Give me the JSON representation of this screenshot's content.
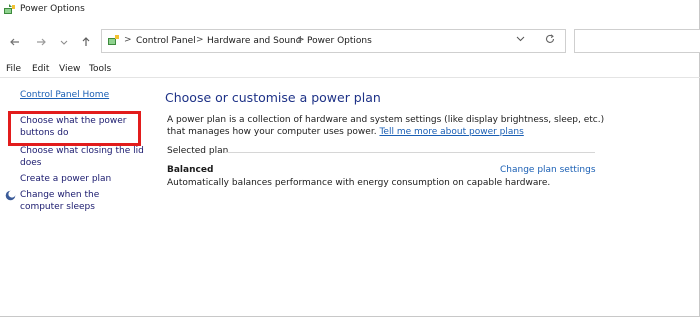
{
  "window": {
    "title": "Power Options"
  },
  "nav": {
    "back_icon": "back-arrow-icon",
    "forward_icon": "forward-arrow-icon",
    "recent_icon": "chevron-down-icon",
    "up_icon": "up-arrow-icon"
  },
  "address": {
    "breadcrumbs": [
      "Control Panel",
      "Hardware and Sound",
      "Power Options"
    ],
    "separator": ">",
    "dropdown_icon": "chevron-down-icon",
    "refresh_icon": "refresh-icon"
  },
  "search": {
    "placeholder": ""
  },
  "menu": {
    "items": [
      "File",
      "Edit",
      "View",
      "Tools"
    ]
  },
  "sidebar": {
    "home": "Control Panel Home",
    "links": [
      "Choose what the power buttons do",
      "Choose what closing the lid does",
      "Create a power plan",
      "Change when the computer sleeps"
    ]
  },
  "main": {
    "heading": "Choose or customise a power plan",
    "description": "A power plan is a collection of hardware and system settings (like display brightness, sleep, etc.) that manages how your computer uses power.",
    "tell_me_link": "Tell me more about power plans",
    "selected_plan_label": "Selected plan",
    "plan_name": "Balanced",
    "change_plan_settings": "Change plan settings",
    "plan_description": "Automatically balances performance with energy consumption on capable hardware."
  },
  "colors": {
    "accent_link": "#1a5fb4",
    "heading": "#1e3287",
    "highlight_box": "#e21c1c"
  }
}
